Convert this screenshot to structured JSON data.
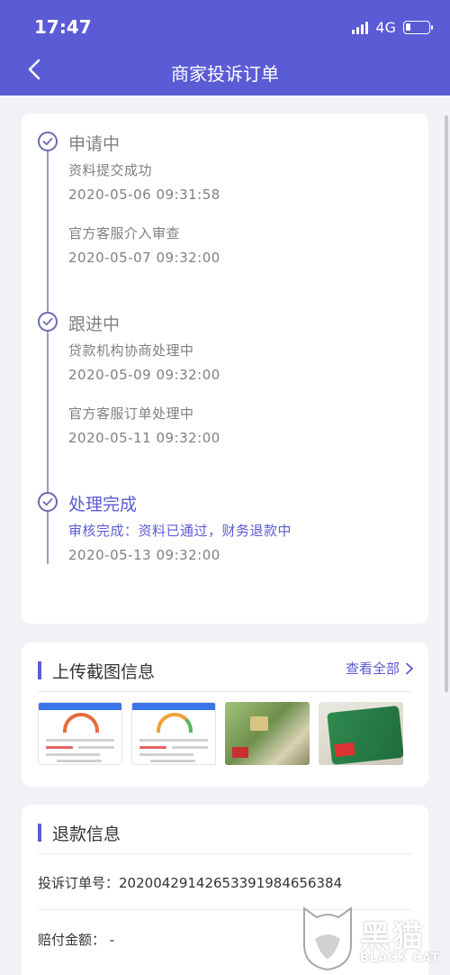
{
  "status_bar": {
    "time": "17:47",
    "network": "4G"
  },
  "header": {
    "title": "商家投诉订单"
  },
  "timeline": {
    "stages": [
      {
        "title": "申请中",
        "entries": [
          {
            "text": "资料提交成功",
            "time": "2020-05-06 09:31:58"
          },
          {
            "text": "官方客服介入审查",
            "time": "2020-05-07 09:32:00"
          }
        ]
      },
      {
        "title": "跟进中",
        "entries": [
          {
            "text": "贷款机构协商处理中",
            "time": "2020-05-09 09:32:00"
          },
          {
            "text": "官方客服订单处理中",
            "time": "2020-05-11 09:32:00"
          }
        ]
      },
      {
        "title": "处理完成",
        "entries": [
          {
            "text": "审核完成：资料已通过，财务退款中",
            "time": "2020-05-13 09:32:00"
          }
        ]
      }
    ]
  },
  "screenshots": {
    "title": "上传截图信息",
    "view_all": "查看全部"
  },
  "refund": {
    "title": "退款信息",
    "order_label": "投诉订单号：",
    "order_no": "20200429142653391984656384",
    "amount_label": "赔付金额：",
    "amount": "-"
  },
  "watermark": {
    "cn": "黑猫",
    "en": "BLACK CAT"
  },
  "colors": {
    "accent": "#5b5bd6",
    "text_gray": "#808080",
    "background": "#f2f2f6"
  }
}
